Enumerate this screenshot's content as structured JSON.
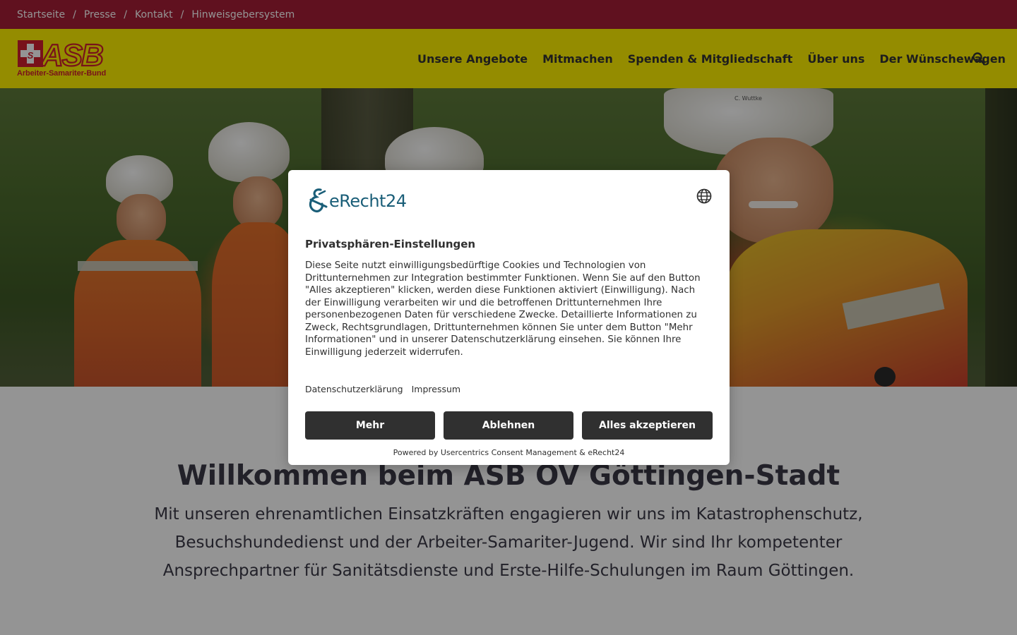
{
  "breadcrumb": {
    "items": [
      "Startseite",
      "Presse",
      "Kontakt",
      "Hinweisgebersystem"
    ],
    "separator": "/"
  },
  "header": {
    "logo_text": "ASB",
    "logo_subtitle": "Arbeiter-Samariter-Bund",
    "nav": [
      "Unsere Angebote",
      "Mitmachen",
      "Spenden & Mitgliedschaft",
      "Über uns",
      "Der Wünschewagen"
    ],
    "search_icon": "search-icon"
  },
  "hero": {
    "helmet_name": "C. Wuttke"
  },
  "welcome": {
    "title": "Willkommen beim ASB OV Göttingen-Stadt",
    "text": "Mit unseren ehrenamtlichen Einsatzkräften engagieren wir uns im Katastrophenschutz, Besuchshundedienst und der Arbeiter-Samariter-Jugend. Wir sind Ihr kompetenter Ansprechpartner für Sanitätsdienste und Erste-Hilfe-Schulungen im Raum Göttingen."
  },
  "consent": {
    "logo_text": "eRecht24",
    "language_icon": "globe-icon",
    "title": "Privatsphären-Einstellungen",
    "body": "Diese Seite nutzt einwilligungsbedürftige Cookies und Technologien von Drittunternehmen zur Integration bestimmter Funktionen. Wenn Sie auf den Button \"Alles akzeptieren\" klicken, werden diese Funktionen aktiviert (Einwilligung). Nach der Einwilligung verarbeiten wir und die betroffenen Drittunternehmen Ihre personenbezogenen Daten für verschiedene Zwecke. Detaillierte Informationen zu Zweck, Rechtsgrundlagen, Drittunternehmen können Sie unter dem Button \"Mehr Informationen\" und in unserer Datenschutzerklärung einsehen. Sie können Ihre Einwilligung jederzeit widerrufen.",
    "links": [
      "Datenschutzerklärung",
      "Impressum"
    ],
    "buttons": {
      "more": "Mehr",
      "deny": "Ablehnen",
      "accept": "Alles akzeptieren"
    },
    "powered_by": "Powered by Usercentrics Consent Management & eRecht24"
  },
  "colors": {
    "topbar": "#a51e36",
    "header": "#fff200",
    "logo_red": "#cf1f2e",
    "button_dark": "#303030",
    "erecht_blue": "#1a5e78"
  }
}
